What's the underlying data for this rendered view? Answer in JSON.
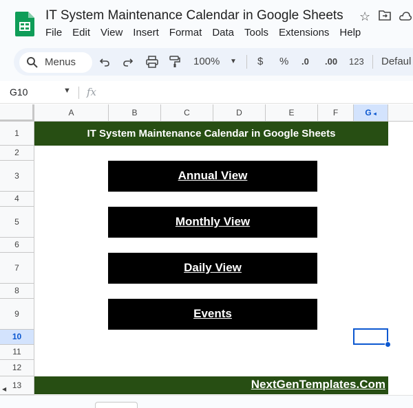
{
  "window": {
    "title": "IT System Maintenance Calendar in Google Sheets"
  },
  "menu": [
    "File",
    "Edit",
    "View",
    "Insert",
    "Format",
    "Data",
    "Tools",
    "Extensions",
    "Help"
  ],
  "toolbar": {
    "search_label": "Menus",
    "zoom": "100%",
    "currency": "$",
    "percent": "%",
    "decrease_decimal": ".0",
    "increase_decimal": ".00",
    "number_format": "123",
    "font": "Defaul"
  },
  "formula_bar": {
    "name_box": "G10",
    "fx_label": "fx"
  },
  "columns": [
    "A",
    "B",
    "C",
    "D",
    "E",
    "F",
    "G"
  ],
  "selected_column": "G",
  "rows": [
    "1",
    "2",
    "3",
    "4",
    "5",
    "6",
    "7",
    "8",
    "9",
    "10",
    "11",
    "12",
    "13"
  ],
  "selected_row": "10",
  "sheet": {
    "banner_title": "IT System Maintenance Calendar in Google Sheets",
    "buttons": [
      "Annual View",
      "Monthly View",
      "Daily View",
      "Events"
    ],
    "footer_link": "NextGenTemplates.Com"
  },
  "colors": {
    "banner_green": "#274e13",
    "button_black": "#000000",
    "selection_blue": "#0b57d0"
  }
}
